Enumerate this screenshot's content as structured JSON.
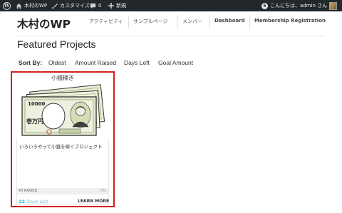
{
  "admin_bar": {
    "site_name": "木村のWP",
    "customize": "カスタマイズ",
    "comments_count": "0",
    "new_label": "新規",
    "greeting": "こんにちは、admin さん"
  },
  "site": {
    "title": "木村のWP"
  },
  "nav": {
    "items": [
      "アクティビティ",
      "サンプルページ",
      "メンバー",
      "Dashboard",
      "Membership Registration"
    ]
  },
  "page": {
    "heading": "Featured Projects"
  },
  "sort": {
    "label": "Sort By:",
    "options": [
      "Oldest",
      "Amount Raised",
      "Days Left",
      "Goal Amount"
    ]
  },
  "project": {
    "title": "小銭稼ぎ",
    "description": "いろいろやって小銭を稼ぐプロジェクト",
    "raised_label": "¥0 RAISED",
    "raised_percent_text": "0%",
    "raised_fraction": 0,
    "days_left_number": "22",
    "days_left_text": "Days Left",
    "learn_more": "LEARN MORE",
    "banknote_value": "10000",
    "banknote_label": "壱万円"
  },
  "colors": {
    "admin_bar_bg": "#23282d",
    "card_highlight": "#d31f1f",
    "days_accent": "#2bb3c0"
  }
}
